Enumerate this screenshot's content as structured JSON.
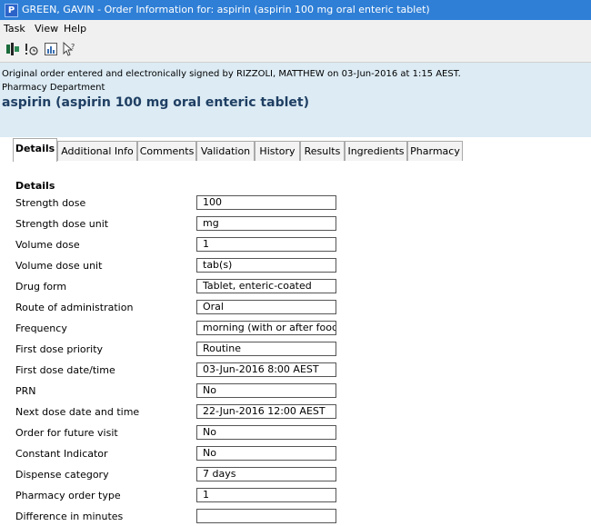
{
  "window": {
    "title": "GREEN, GAVIN - Order Information for:  aspirin (aspirin 100 mg oral enteric tablet)",
    "icon_letter": "P"
  },
  "menu": {
    "items": [
      "Task",
      "View",
      "Help"
    ]
  },
  "toolbar": {
    "icons": [
      "order-action-icon",
      "priority-clock-icon",
      "report-icon",
      "help-pointer-icon"
    ]
  },
  "header": {
    "signed_line": "Original order entered and electronically signed by RIZZOLI, MATTHEW on 03-Jun-2016 at 1:15 AEST.",
    "department": "Pharmacy Department",
    "drug_title": "aspirin (aspirin 100 mg oral enteric tablet)"
  },
  "tabs": [
    {
      "label": "Details",
      "active": true
    },
    {
      "label": "Additional Info"
    },
    {
      "label": "Comments"
    },
    {
      "label": "Validation"
    },
    {
      "label": "History"
    },
    {
      "label": "Results"
    },
    {
      "label": "Ingredients"
    },
    {
      "label": "Pharmacy"
    }
  ],
  "details": {
    "section_title": "Details",
    "fields": [
      {
        "label": "Strength dose",
        "value": "100"
      },
      {
        "label": "Strength dose unit",
        "value": "mg"
      },
      {
        "label": "Volume dose",
        "value": "1"
      },
      {
        "label": "Volume dose unit",
        "value": "tab(s)"
      },
      {
        "label": "Drug form",
        "value": "Tablet, enteric-coated"
      },
      {
        "label": "Route of administration",
        "value": "Oral"
      },
      {
        "label": "Frequency",
        "value": "morning (with or after food)"
      },
      {
        "label": "First dose priority",
        "value": "Routine"
      },
      {
        "label": "First dose date/time",
        "value": "03-Jun-2016 8:00 AEST"
      },
      {
        "label": "PRN",
        "value": "No"
      },
      {
        "label": "Next dose date and time",
        "value": "22-Jun-2016 12:00 AEST"
      },
      {
        "label": "Order for future visit",
        "value": "No"
      },
      {
        "label": "Constant Indicator",
        "value": "No"
      },
      {
        "label": "Dispense category",
        "value": "7 days"
      },
      {
        "label": "Pharmacy order type",
        "value": "1"
      },
      {
        "label": "Difference in minutes",
        "value": ""
      }
    ]
  },
  "colors": {
    "titlebar": "#2f7fd6",
    "header_bg": "#dcebf4",
    "drug_title": "#1f3f63"
  }
}
